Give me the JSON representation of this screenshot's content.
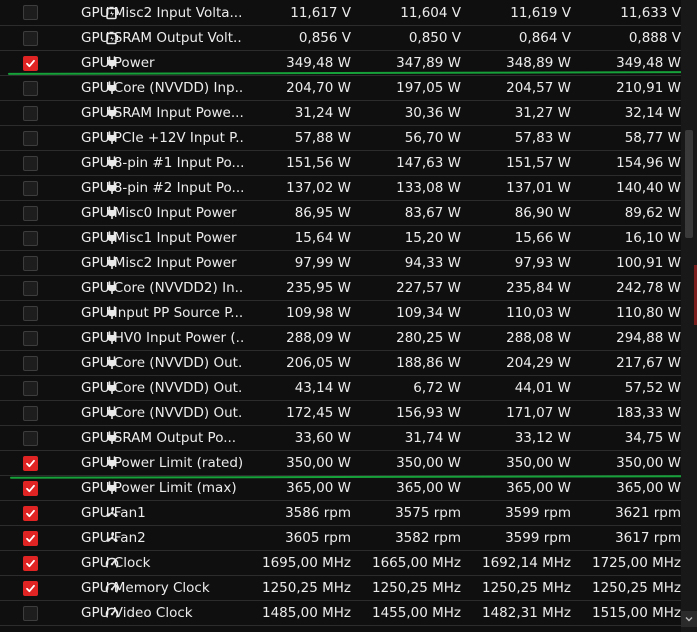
{
  "colors": {
    "accent_red": "#e02424",
    "marker_green": "#17a13a",
    "row_border": "#2c2c2c",
    "background": "#0f0f0f"
  },
  "rows": [
    {
      "checked": false,
      "icon": "battery-icon",
      "label": "GPU Misc2 Input Volta...",
      "values": [
        "11,617 V",
        "11,604 V",
        "11,619 V",
        "11,633 V"
      ]
    },
    {
      "checked": false,
      "icon": "battery-icon",
      "label": "GPU SRAM Output Volt...",
      "values": [
        "0,856 V",
        "0,850 V",
        "0,864 V",
        "0,888 V"
      ]
    },
    {
      "checked": true,
      "icon": "power-plug-icon",
      "label": "GPU Power",
      "values": [
        "349,48 W",
        "347,89 W",
        "348,89 W",
        "349,48 W"
      ]
    },
    {
      "checked": false,
      "icon": "power-plug-icon",
      "label": "GPU Core (NVVDD) Inp...",
      "values": [
        "204,70 W",
        "197,05 W",
        "204,57 W",
        "210,91 W"
      ]
    },
    {
      "checked": false,
      "icon": "power-plug-icon",
      "label": "GPU SRAM Input Powe...",
      "values": [
        "31,24 W",
        "30,36 W",
        "31,27 W",
        "32,14 W"
      ]
    },
    {
      "checked": false,
      "icon": "power-plug-icon",
      "label": "GPU PCIe +12V Input P...",
      "values": [
        "57,88 W",
        "56,70 W",
        "57,83 W",
        "58,77 W"
      ]
    },
    {
      "checked": false,
      "icon": "power-plug-icon",
      "label": "GPU 8-pin #1 Input Po...",
      "values": [
        "151,56 W",
        "147,63 W",
        "151,57 W",
        "154,96 W"
      ]
    },
    {
      "checked": false,
      "icon": "power-plug-icon",
      "label": "GPU 8-pin #2 Input Po...",
      "values": [
        "137,02 W",
        "133,08 W",
        "137,01 W",
        "140,40 W"
      ]
    },
    {
      "checked": false,
      "icon": "power-plug-icon",
      "label": "GPU Misc0 Input Power",
      "values": [
        "86,95 W",
        "83,67 W",
        "86,90 W",
        "89,62 W"
      ]
    },
    {
      "checked": false,
      "icon": "power-plug-icon",
      "label": "GPU Misc1 Input Power",
      "values": [
        "15,64 W",
        "15,20 W",
        "15,66 W",
        "16,10 W"
      ]
    },
    {
      "checked": false,
      "icon": "power-plug-icon",
      "label": "GPU Misc2 Input Power",
      "values": [
        "97,99 W",
        "94,33 W",
        "97,93 W",
        "100,91 W"
      ]
    },
    {
      "checked": false,
      "icon": "power-plug-icon",
      "label": "GPU Core (NVVDD2) In...",
      "values": [
        "235,95 W",
        "227,57 W",
        "235,84 W",
        "242,78 W"
      ]
    },
    {
      "checked": false,
      "icon": "power-plug-icon",
      "label": "GPU Input PP Source P...",
      "values": [
        "109,98 W",
        "109,34 W",
        "110,03 W",
        "110,80 W"
      ]
    },
    {
      "checked": false,
      "icon": "power-plug-icon",
      "label": "GPU HV0 Input Power (...",
      "values": [
        "288,09 W",
        "280,25 W",
        "288,08 W",
        "294,88 W"
      ]
    },
    {
      "checked": false,
      "icon": "power-plug-icon",
      "label": "GPU Core (NVVDD) Out...",
      "values": [
        "206,05 W",
        "188,86 W",
        "204,29 W",
        "217,67 W"
      ]
    },
    {
      "checked": false,
      "icon": "power-plug-icon",
      "label": "GPU Core (NVVDD) Out...",
      "values": [
        "43,14 W",
        "6,72 W",
        "44,01 W",
        "57,52 W"
      ]
    },
    {
      "checked": false,
      "icon": "power-plug-icon",
      "label": "GPU Core (NVVDD) Out...",
      "values": [
        "172,45 W",
        "156,93 W",
        "171,07 W",
        "183,33 W"
      ]
    },
    {
      "checked": false,
      "icon": "power-plug-icon",
      "label": "GPU SRAM Output Po...",
      "values": [
        "33,60 W",
        "31,74 W",
        "33,12 W",
        "34,75 W"
      ]
    },
    {
      "checked": true,
      "icon": "power-plug-icon",
      "label": "GPU Power Limit (rated)",
      "values": [
        "350,00 W",
        "350,00 W",
        "350,00 W",
        "350,00 W"
      ]
    },
    {
      "checked": true,
      "icon": "power-plug-icon",
      "label": "GPU Power Limit (max)",
      "values": [
        "365,00 W",
        "365,00 W",
        "365,00 W",
        "365,00 W"
      ]
    },
    {
      "checked": true,
      "icon": "fan-icon",
      "label": "GPU Fan1",
      "values": [
        "3586 rpm",
        "3575 rpm",
        "3599 rpm",
        "3621 rpm"
      ]
    },
    {
      "checked": true,
      "icon": "fan-icon",
      "label": "GPU Fan2",
      "values": [
        "3605 rpm",
        "3582 rpm",
        "3599 rpm",
        "3617 rpm"
      ]
    },
    {
      "checked": true,
      "icon": "clock-gauge-icon",
      "label": "GPU Clock",
      "values": [
        "1695,00 MHz",
        "1665,00 MHz",
        "1692,14 MHz",
        "1725,00 MHz"
      ]
    },
    {
      "checked": true,
      "icon": "clock-gauge-icon",
      "label": "GPU Memory Clock",
      "values": [
        "1250,25 MHz",
        "1250,25 MHz",
        "1250,25 MHz",
        "1250,25 MHz"
      ]
    },
    {
      "checked": false,
      "icon": "clock-gauge-icon",
      "label": "GPU Video Clock",
      "values": [
        "1485,00 MHz",
        "1455,00 MHz",
        "1482,31 MHz",
        "1515,00 MHz"
      ]
    }
  ]
}
